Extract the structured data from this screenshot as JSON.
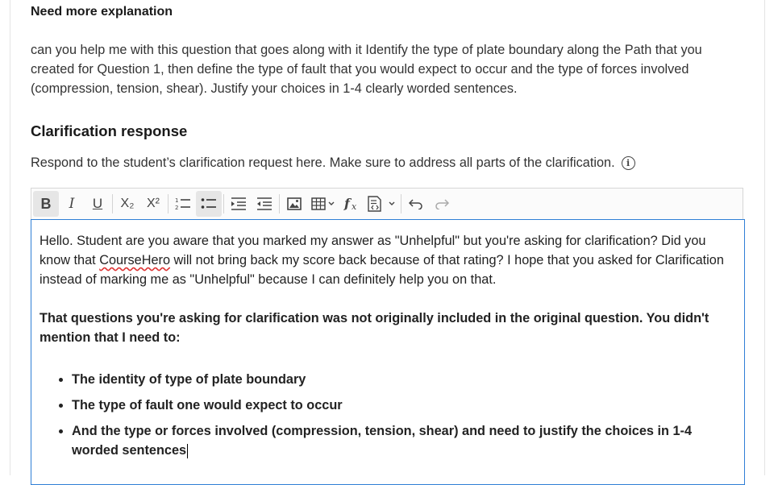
{
  "header": {
    "title": "Need more explanation"
  },
  "question": {
    "text": "can you help me with this question  that goes along with it Identify the type of plate boundary along the Path that you created for Question 1, then define the type of fault that you would expect to occur and the type of forces involved (compression, tension, shear). Justify your choices in 1-4 clearly worded sentences."
  },
  "clarification": {
    "title": "Clarification response",
    "instruction": "Respond to the student’s clarification request here. Make sure to address all parts of the clarification.",
    "info_icon": "info-circle-icon"
  },
  "toolbar": {
    "bold": "B",
    "italic": "I",
    "underline": "U",
    "subscript": "X₂",
    "superscript": "X²"
  },
  "editor": {
    "para1_a": "Hello. Student are you aware that you marked my answer as \"Unhelpful\" but you're asking for clarification? Did you know that ",
    "para1_link": "CourseHero",
    "para1_b": " will not bring back my score back because of that rating? I hope that you asked for Clarification instead of marking me as \"Unhelpful\" because I can definitely help you on that.",
    "para2": "That questions you're asking for clarification was not originally included in the original question. You didn't mention that I need to:",
    "bullets": [
      "The identity of type of plate boundary",
      "The type of fault one would expect to occur",
      "And the type or forces involved (compression, tension, shear) and need to justify the choices in 1-4 worded sentences"
    ]
  },
  "colors": {
    "editor_focus_border": "#2f7fd6",
    "text": "#333333"
  }
}
